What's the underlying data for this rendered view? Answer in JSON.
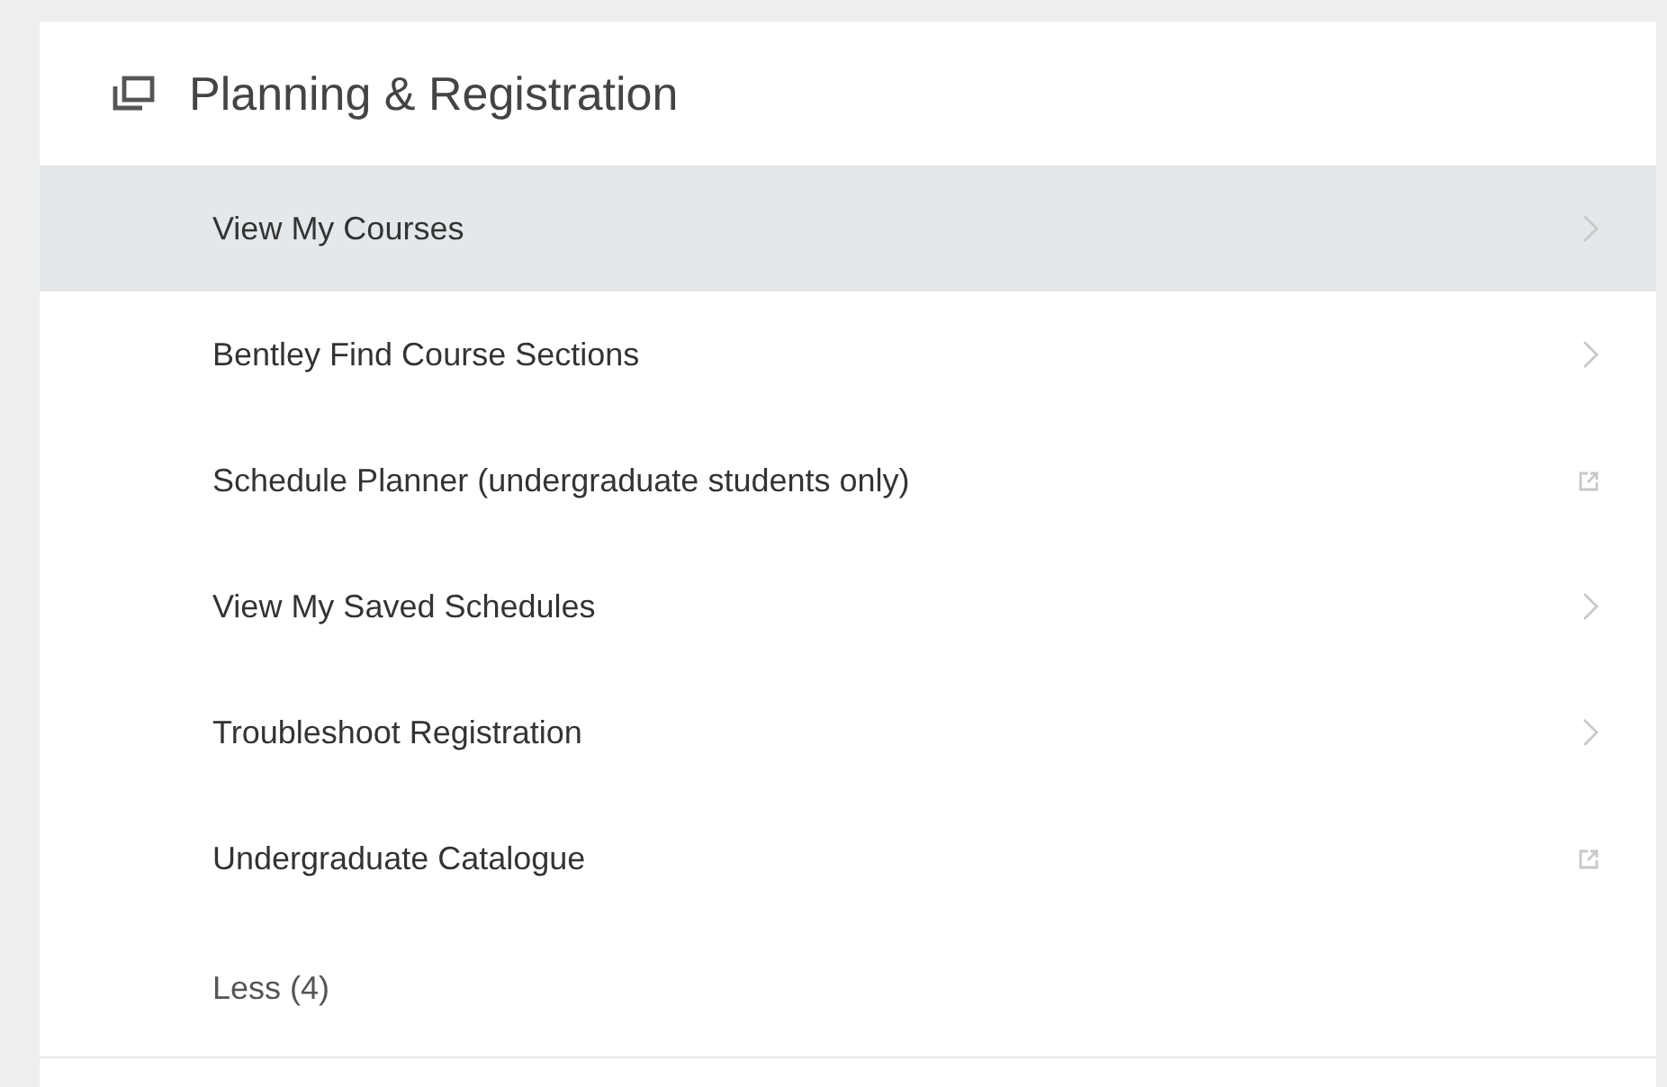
{
  "section": {
    "title": "Planning & Registration"
  },
  "items": [
    {
      "label": "View My Courses",
      "kind": "chevron",
      "selected": true
    },
    {
      "label": "Bentley Find Course Sections",
      "kind": "chevron",
      "selected": false
    },
    {
      "label": "Schedule Planner (undergraduate students only)",
      "kind": "external",
      "selected": false
    },
    {
      "label": "View My Saved Schedules",
      "kind": "chevron",
      "selected": false
    },
    {
      "label": "Troubleshoot Registration",
      "kind": "chevron",
      "selected": false
    },
    {
      "label": "Undergraduate Catalogue",
      "kind": "external",
      "selected": false
    }
  ],
  "toggle": {
    "label": "Less (4)"
  }
}
